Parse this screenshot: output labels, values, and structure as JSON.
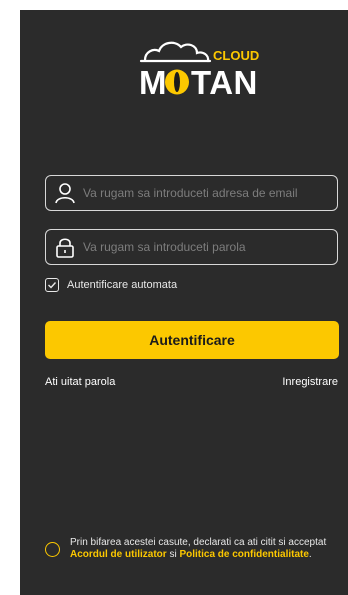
{
  "brand": {
    "name": "MOTAN",
    "sub": "CLOUD",
    "accent": "#fcc800",
    "background": "#2b2b2b"
  },
  "login": {
    "email_placeholder": "Va rugam sa introduceti adresa de email",
    "password_placeholder": "Va rugam sa introduceti parola",
    "email_value": "",
    "password_value": "",
    "auto_login_label": "Autentificare automata",
    "auto_login_checked": true,
    "submit_label": "Autentificare",
    "forgot_label": "Ati uitat parola",
    "register_label": "Inregistrare"
  },
  "agreement": {
    "text_before": "Prin bifarea acestei casute, declarati ca ati citit si acceptat ",
    "terms_link": "Acordul de utilizator",
    "and": " si ",
    "privacy_link": "Politica de confidentialitate",
    "text_after": ".",
    "checked": false
  },
  "icons": {
    "user": "user-icon",
    "lock": "lock-icon",
    "checkbox": "checkbox-checked-icon",
    "radio": "radio-empty-icon"
  }
}
